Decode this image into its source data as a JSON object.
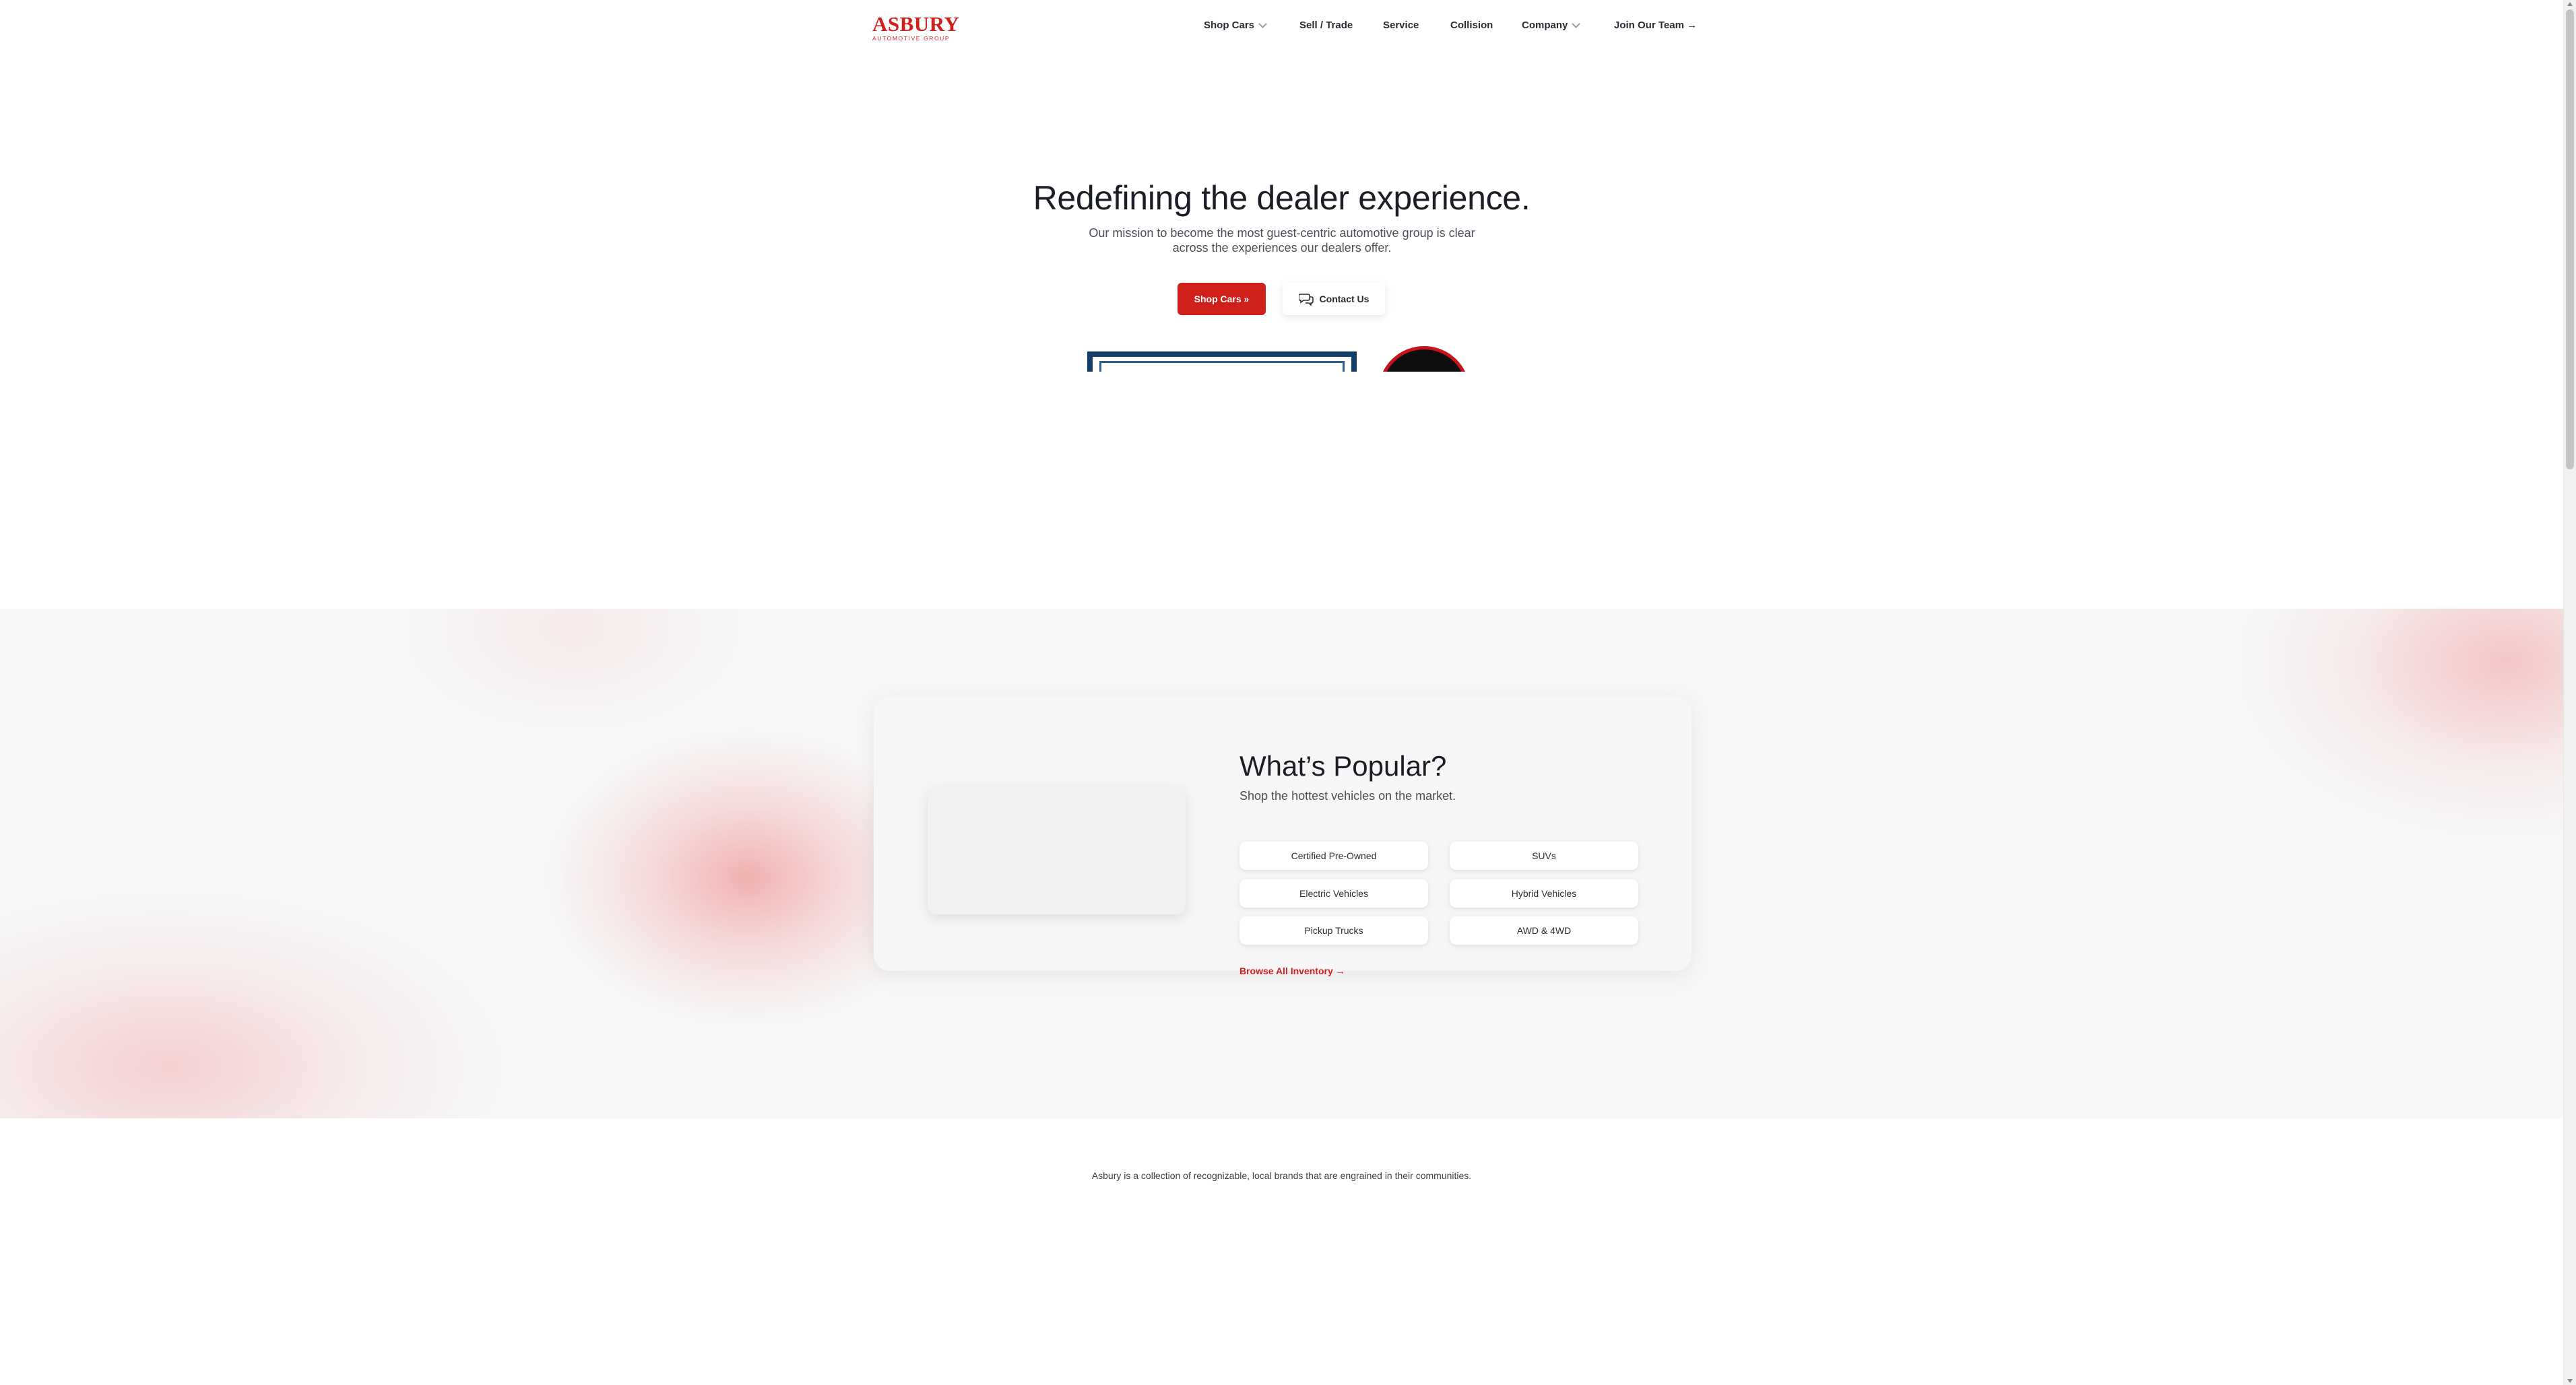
{
  "brand": {
    "logo_main": "ASBURY",
    "logo_sub": "AUTOMOTIVE GROUP",
    "color": "#d0201c"
  },
  "nav": {
    "shop_cars": "Shop Cars",
    "sell_trade": "Sell / Trade",
    "service": "Service",
    "collision": "Collision",
    "company": "Company",
    "join_team": "Join Our Team →"
  },
  "hero": {
    "title": "Redefining the dealer experience.",
    "subtitle": "Our mission to become the most guest-centric automotive group is clear across the experiences our dealers offer.",
    "shop_button": "Shop Cars »",
    "contact_button": "Contact Us"
  },
  "popular": {
    "title": "What’s Popular?",
    "subtitle": "Shop the hottest vehicles on the market.",
    "categories": [
      "Certified Pre-Owned",
      "SUVs",
      "Electric Vehicles",
      "Hybrid Vehicles",
      "Pickup Trucks",
      "AWD & 4WD"
    ],
    "browse_link": "Browse All Inventory →"
  },
  "brands": {
    "text": "Asbury is a collection of recognizable, local brands that are engrained in their communities."
  },
  "icons": {
    "chevron": "chevron-down-icon",
    "chat": "chat-bubbles-icon"
  }
}
